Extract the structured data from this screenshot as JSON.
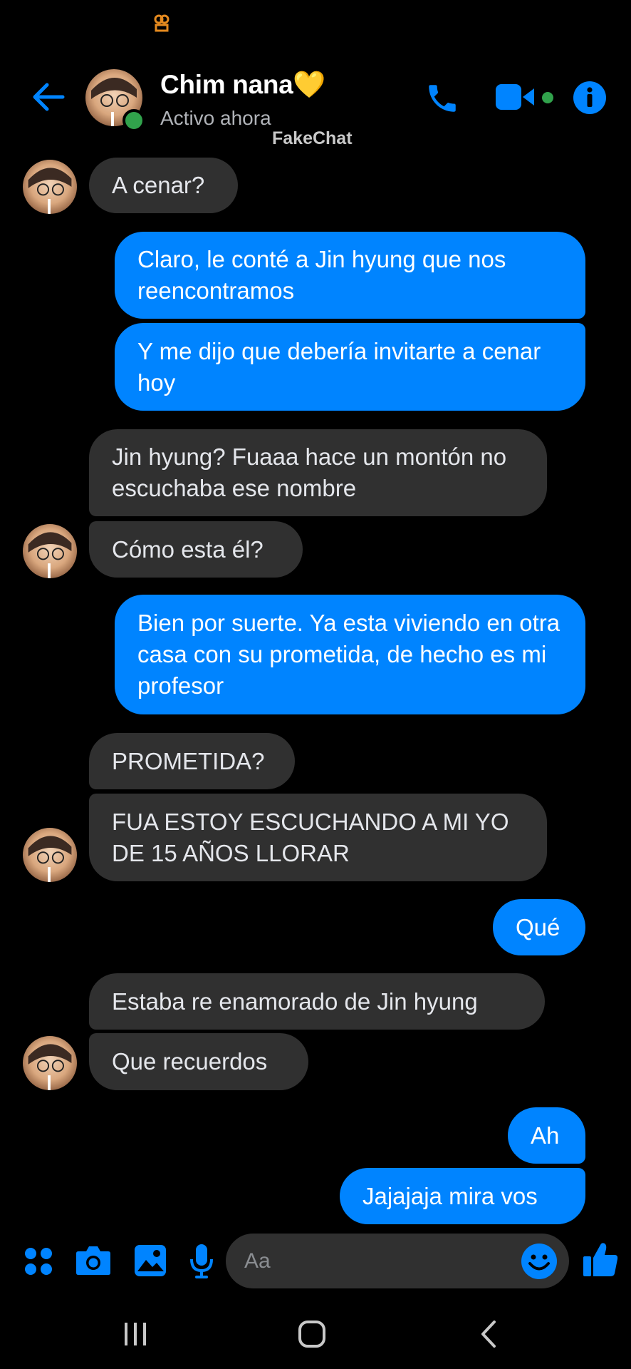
{
  "header": {
    "name": "Chim nana💛",
    "status": "Activo ahora",
    "watermark": "FakeChat"
  },
  "messages": [
    {
      "from": "them",
      "text": "A cenar?"
    },
    {
      "from": "me",
      "text": "Claro, le conté a Jin hyung que nos reencontramos"
    },
    {
      "from": "me",
      "text": "Y me dijo que debería invitarte a cenar hoy"
    },
    {
      "from": "them",
      "text": "Jin hyung? Fuaaa hace un montón no escuchaba ese nombre"
    },
    {
      "from": "them",
      "text": "Cómo esta él?"
    },
    {
      "from": "me",
      "text": "Bien por suerte. Ya esta viviendo en otra casa con su prometida, de hecho es mi profesor"
    },
    {
      "from": "them",
      "text": "PROMETIDA?"
    },
    {
      "from": "them",
      "text": "FUA ESTOY ESCUCHANDO A MI YO DE 15 AÑOS LLORAR"
    },
    {
      "from": "me",
      "text": "Qué"
    },
    {
      "from": "them",
      "text": "Estaba re enamorado de Jin hyung"
    },
    {
      "from": "them",
      "text": "Que recuerdos"
    },
    {
      "from": "me",
      "text": "Ah"
    },
    {
      "from": "me",
      "text": "Jajajaja mira vos"
    }
  ],
  "composer": {
    "placeholder": "Aa"
  },
  "icons": {
    "back": "back-arrow-icon",
    "call": "phone-icon",
    "video": "video-camera-icon",
    "info": "info-icon",
    "menu": "apps-grid-icon",
    "camera": "camera-icon",
    "gallery": "image-icon",
    "mic": "microphone-icon",
    "emoji": "emoji-icon",
    "like": "thumbs-up-icon",
    "recents": "recents-icon",
    "home": "home-icon",
    "nav_back": "nav-back-icon"
  },
  "colors": {
    "accent": "#0084ff",
    "incoming_bubble": "#303030",
    "online": "#31a24c",
    "background": "#000000"
  }
}
